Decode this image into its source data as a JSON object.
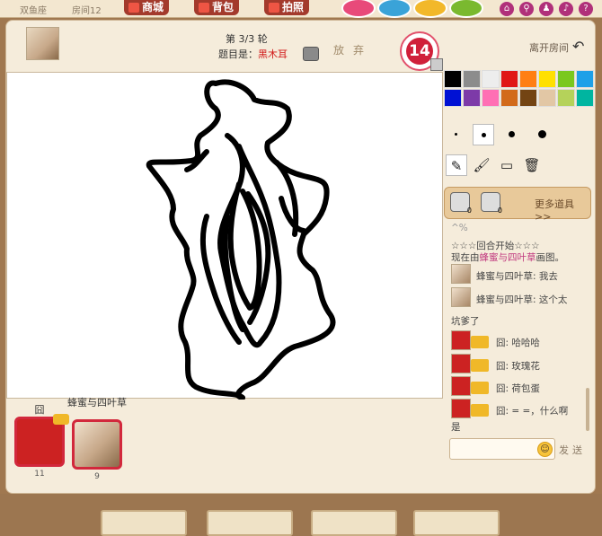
{
  "topbar": {
    "room_type": "双鱼座",
    "room_no": "房间12",
    "mall_label": "商城",
    "bag_label": "背包",
    "photo_label": "拍照",
    "balloons": [
      "#e84a7a",
      "#3aa3d8",
      "#f2b82a",
      "#7ab92f"
    ],
    "icons": [
      "home-icon",
      "search-icon",
      "user-icon",
      "sound-icon",
      "help-icon"
    ]
  },
  "header": {
    "round": "第 3/3 轮",
    "topic_prefix": "题目是：",
    "topic_answer": "黑木耳",
    "giveup_label": "放弃",
    "timer": "14",
    "leave_label": "离开房间"
  },
  "palette": [
    "#000000",
    "#8c8c8c",
    "#ededed",
    "#e01616",
    "#ff7f14",
    "#ffe000",
    "#7ac81e",
    "#1ea0e8",
    "#0011d4",
    "#7d3aa8",
    "#ff6fb4",
    "#d26a1a",
    "#734413",
    "#e2c7a5",
    "#b5d25a",
    "#00b5a0"
  ],
  "players": [
    {
      "name": "囧",
      "score": "11"
    },
    {
      "name": "蜂蜜与四叶草",
      "score": "9"
    }
  ],
  "props": {
    "item1_count": "0",
    "item2_count": "0",
    "more_label": "更多道具>>"
  },
  "chat": {
    "top_cut": "^%",
    "round_start": "☆☆☆回合开始☆☆☆",
    "now_drawing_prefix": "现在由",
    "now_drawing_name": "蜂蜜与四叶草",
    "now_drawing_suffix": "画图。",
    "messages": [
      {
        "who": "蜂蜜与四叶草",
        "text": "蜂蜜与四叶草: 我去"
      },
      {
        "who": "蜂蜜与四叶草",
        "text": "蜂蜜与四叶草: 这个太"
      },
      {
        "text": "坑爹了"
      },
      {
        "who": "囧",
        "text": "囧: 哈哈哈"
      },
      {
        "who": "囧",
        "text": "囧: 玫瑰花"
      },
      {
        "who": "囧",
        "text": "囧: 荷包蛋"
      },
      {
        "who": "囧",
        "text": "囧: = =，什么啊"
      },
      {
        "text": "是"
      }
    ],
    "send_label": "发送"
  }
}
